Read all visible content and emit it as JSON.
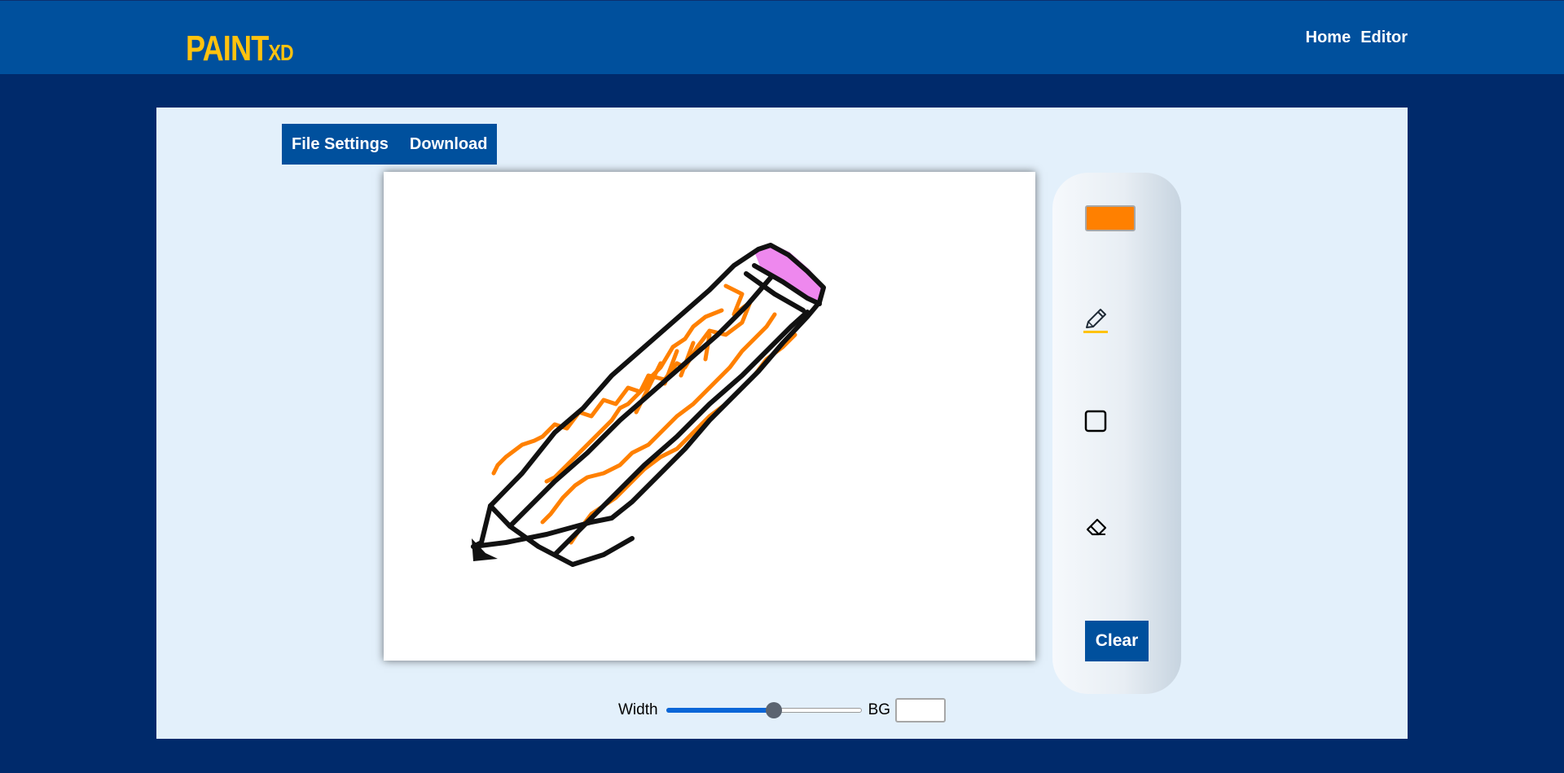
{
  "brand": {
    "logo_big": "PAINT",
    "logo_small": "XD",
    "color": "#ffc20e"
  },
  "nav": {
    "items": [
      {
        "label": "Home"
      },
      {
        "label": "Editor"
      }
    ]
  },
  "menu": {
    "file_settings": "File Settings",
    "download": "Download"
  },
  "toolbar": {
    "current_color": "#ff8000",
    "tools": [
      {
        "name": "pencil-icon",
        "active": true
      },
      {
        "name": "rectangle-icon",
        "active": false
      },
      {
        "name": "eraser-icon",
        "active": false
      }
    ],
    "clear_label": "Clear"
  },
  "controls": {
    "width_label": "Width",
    "width_fraction": 0.55,
    "bg_label": "BG",
    "bg_color": "#ffffff"
  },
  "colors": {
    "primary": "#00509d",
    "page_bg": "#002a6b",
    "panel_bg": "#e3f0fb",
    "accent": "#ffc20e"
  }
}
